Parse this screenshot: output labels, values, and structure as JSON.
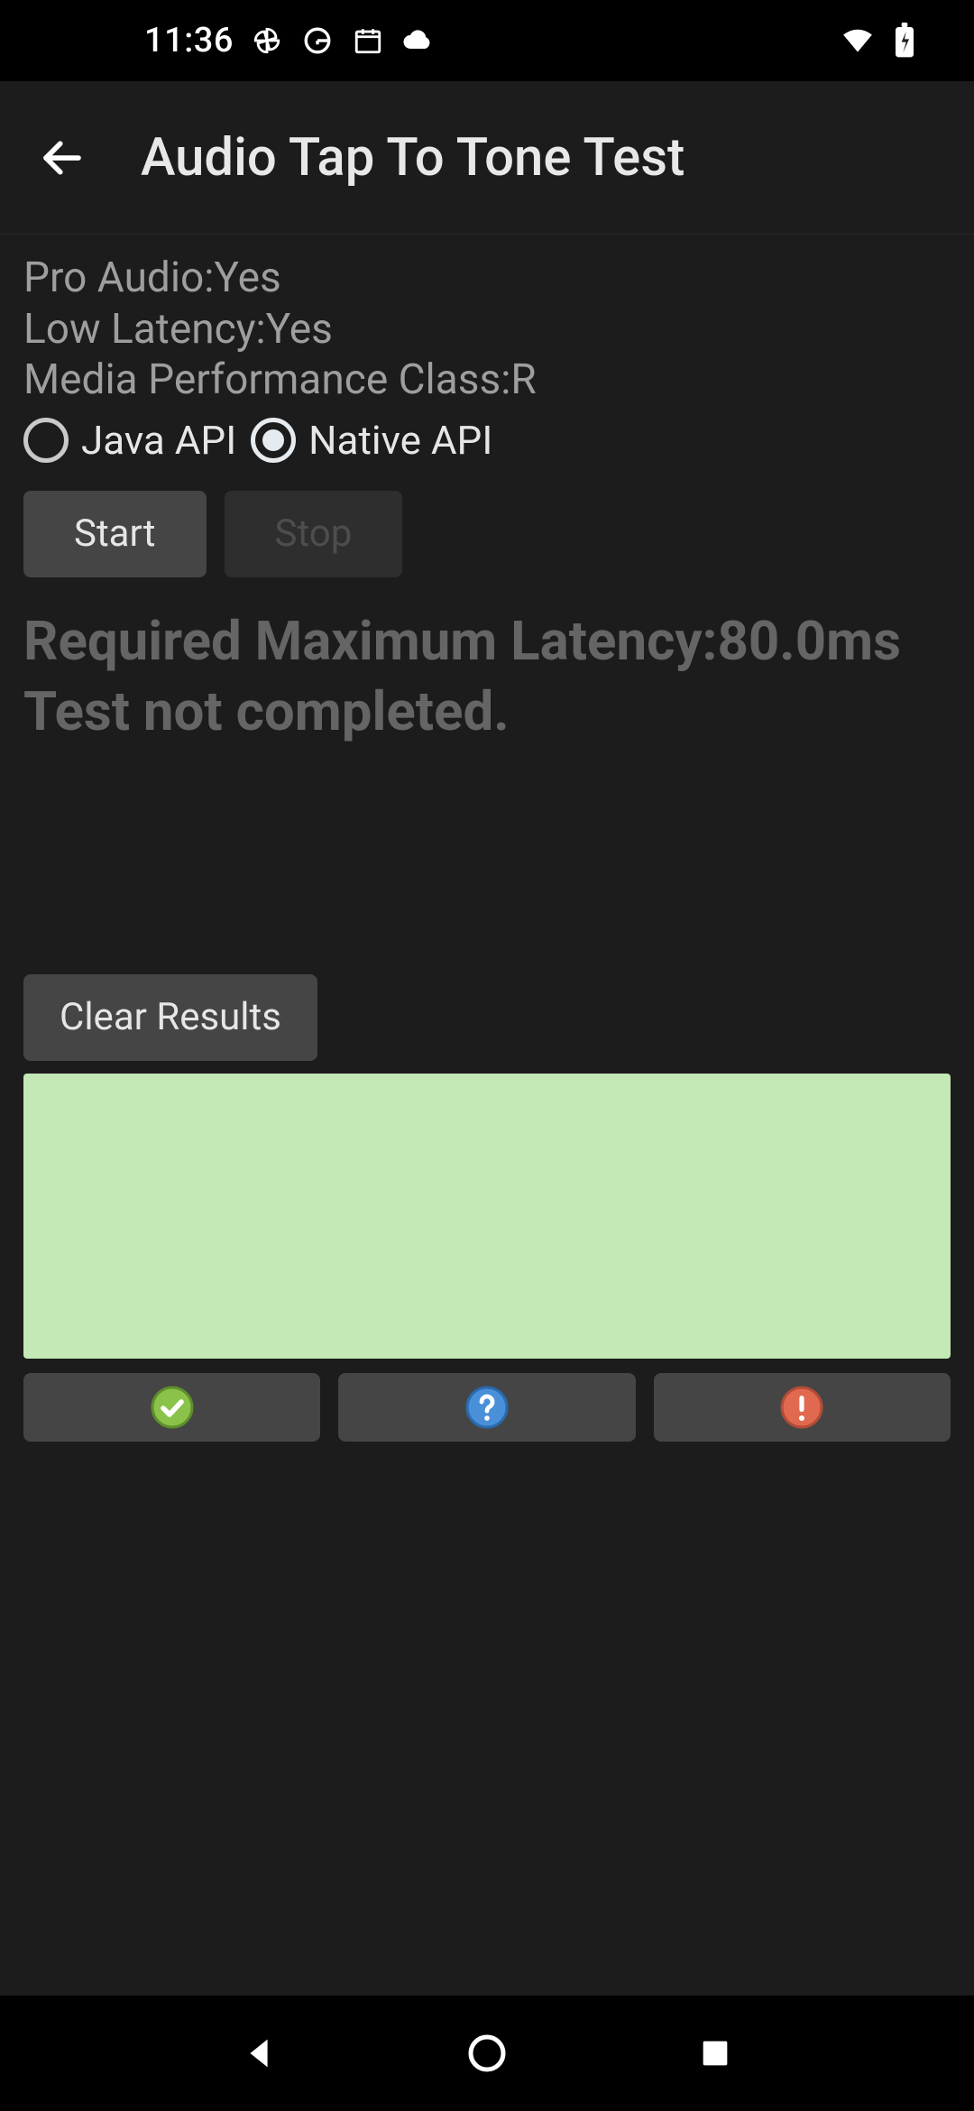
{
  "status_bar": {
    "time": "11:36"
  },
  "app_bar": {
    "title": "Audio Tap To Tone Test"
  },
  "info": {
    "pro_audio": "Pro Audio:Yes",
    "low_latency": "Low Latency:Yes",
    "media_perf_class": "Media Performance Class:R"
  },
  "radios": {
    "java_api_label": "Java API",
    "native_api_label": "Native API",
    "selected": "native"
  },
  "controls": {
    "start_label": "Start",
    "stop_label": "Stop",
    "stop_enabled": false,
    "clear_results_label": "Clear Results"
  },
  "status_text": {
    "line1": "Required Maximum Latency:80.0ms",
    "line2": "Test not completed."
  },
  "tap_panel_color": "#c4e9b6",
  "result_buttons": {
    "pass_icon": "pass",
    "info_icon": "info",
    "fail_icon": "fail"
  }
}
